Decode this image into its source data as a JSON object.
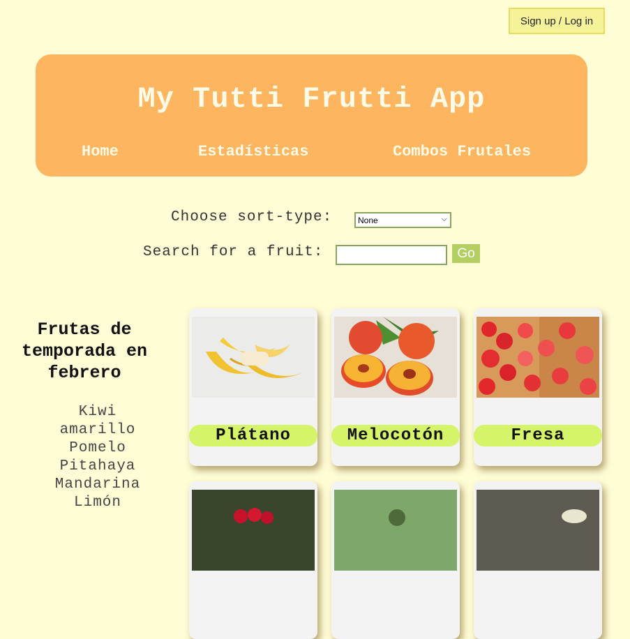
{
  "auth": {
    "login_label": "Sign up / Log in"
  },
  "header": {
    "title": "My Tutti Frutti App",
    "nav": [
      "Home",
      "Estadísticas",
      "Combos Frutales"
    ]
  },
  "controls": {
    "sort_label": "Choose sort-type:",
    "sort_value": "None",
    "search_label": "Search for a fruit:",
    "search_value": "",
    "go_label": "Go"
  },
  "season": {
    "title": "Frutas de temporada en febrero",
    "items": [
      "Kiwi amarillo",
      "Pomelo",
      "Pitahaya",
      "Mandarina",
      "Limón"
    ]
  },
  "fruits": [
    {
      "name": "Plátano"
    },
    {
      "name": "Melocotón"
    },
    {
      "name": "Fresa"
    }
  ],
  "colors": {
    "background": "#fffdd6",
    "header": "#fdb55f",
    "name_pill": "#d6f46a",
    "go_button": "#b3cf62"
  }
}
